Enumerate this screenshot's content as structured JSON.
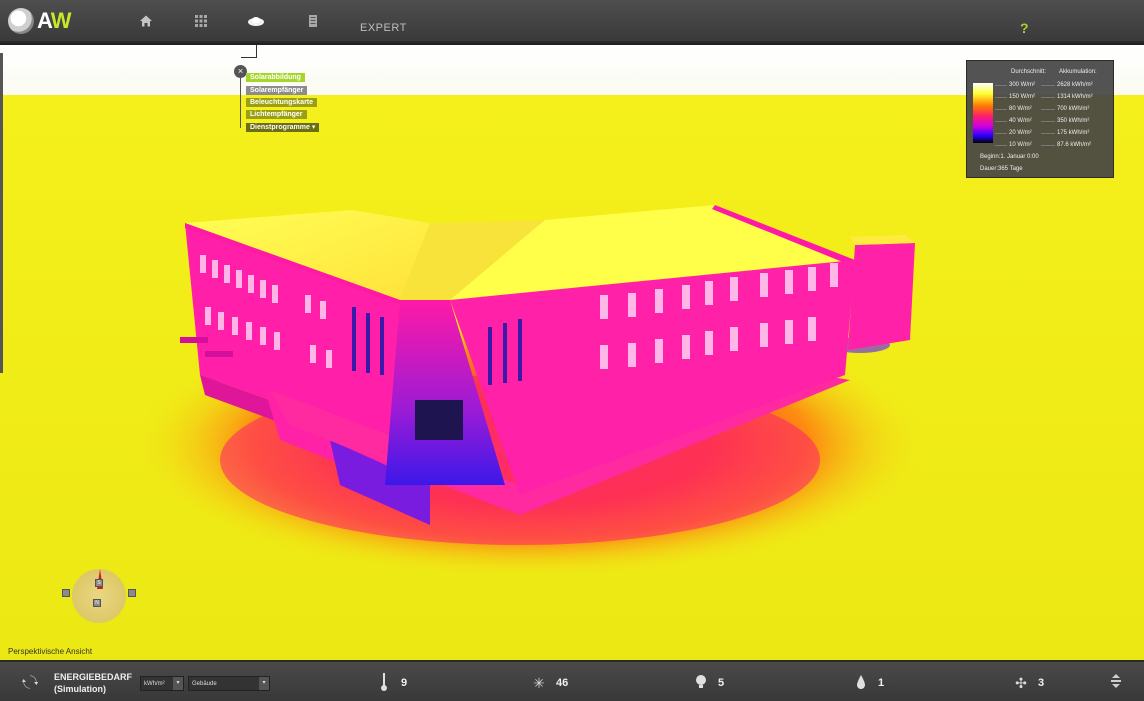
{
  "header": {
    "logo_prefix": "A",
    "logo_suffix": "W",
    "nav_expert": "EXPERT",
    "help": "?"
  },
  "tree_menu": {
    "close": "×",
    "items": [
      {
        "label": "Solarabbildung",
        "state": "active"
      },
      {
        "label": "Solarempfänger",
        "state": "gray"
      },
      {
        "label": "Beleuchtungskarte",
        "state": "olive"
      },
      {
        "label": "Lichtempfänger",
        "state": "olive"
      },
      {
        "label": "Dienstprogramme",
        "state": "dark",
        "expand": "▾"
      }
    ]
  },
  "legend": {
    "header_avg": "Durchschnitt:",
    "header_acc": "Akkumulation:",
    "rows": [
      {
        "avg": "300 W/m²",
        "acc": "2628 kWh/m²"
      },
      {
        "avg": "150 W/m²",
        "acc": "1314 kWh/m²"
      },
      {
        "avg": "80 W/m²",
        "acc": "700 kWh/m²"
      },
      {
        "avg": "40 W/m²",
        "acc": "350 kWh/m²"
      },
      {
        "avg": "20 W/m²",
        "acc": "175 kWh/m²"
      },
      {
        "avg": "10 W/m²",
        "acc": "87.6 kWh/m²"
      }
    ],
    "begin": "Beginn:1. Januar 0:00",
    "duration": "Dauer:365 Tage"
  },
  "compass": {
    "top": "S",
    "bottom": "N"
  },
  "view_label": "Perspektivische Ansicht",
  "bottom": {
    "title": "ENERGIEBEDARF",
    "subtitle": "(Simulation)",
    "unit_select": "kWh/m²",
    "scope_select": "Gebäude",
    "stats": {
      "temperature": "9",
      "sun": "46",
      "light": "5",
      "water": "1",
      "wind": "3"
    }
  }
}
